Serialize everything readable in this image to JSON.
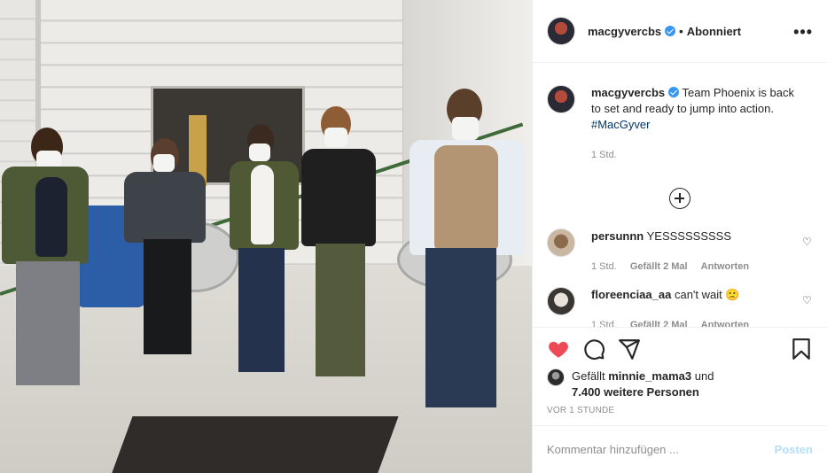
{
  "post": {
    "username": "macgyvercbs",
    "follow_status": "Abonniert",
    "separator": "•",
    "more_label": "•••",
    "caption": "Team Phoenix is back to set and ready to jump into action.",
    "hashtag": "#MacGyver",
    "caption_time": "1 Std."
  },
  "comments": [
    {
      "username": "persunnn",
      "text": "YESSSSSSSSS",
      "time": "1 Std.",
      "likes": "Gefällt 2 Mal",
      "reply": "Antworten"
    },
    {
      "username": "floreenciaa_aa",
      "text": "can't wait 🙁",
      "time": "1 Std.",
      "likes": "Gefällt 2 Mal",
      "reply": "Antworten"
    }
  ],
  "actions": {
    "likes_prefix": "Gefällt",
    "likes_user": "minnie_mama3",
    "likes_and": "und",
    "likes_others": "7.400 weitere Personen",
    "posted_time": "VOR 1 STUNDE"
  },
  "comment_box": {
    "placeholder": "Kommentar hinzufügen ...",
    "post_label": "Posten"
  },
  "colors": {
    "like_red": "#ed4956",
    "link_blue": "#00376b",
    "verified_blue": "#3897f0",
    "post_disabled": "#b2dffc"
  },
  "icons": [
    "heart-icon",
    "comment-icon",
    "share-icon",
    "bookmark-icon",
    "verified-icon",
    "more-icon",
    "plus-circle-icon"
  ]
}
